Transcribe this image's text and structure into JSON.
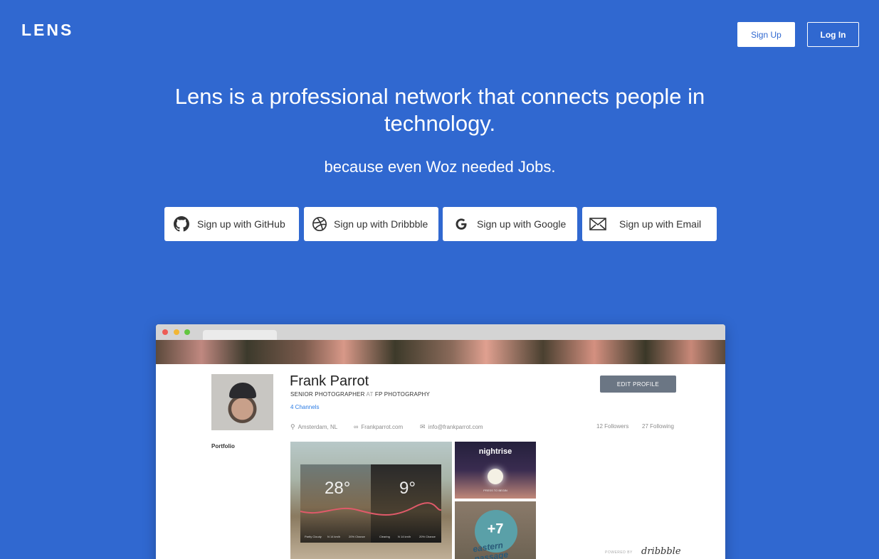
{
  "header": {
    "logo": "LENS",
    "signup_label": "Sign Up",
    "login_label": "Log In"
  },
  "hero": {
    "headline": "Lens is a professional network that connects people in technology.",
    "subline": "because even Woz needed Jobs."
  },
  "providers": [
    {
      "label": "Sign up with GitHub",
      "icon": "github-icon"
    },
    {
      "label": "Sign up with Dribbble",
      "icon": "dribbble-icon"
    },
    {
      "label": "Sign up with Google",
      "icon": "google-icon"
    },
    {
      "label": "Sign up with Email",
      "icon": "email-icon"
    }
  ],
  "mockup": {
    "window_dot_colors": [
      "#ee5c54",
      "#f2b634",
      "#63c640"
    ],
    "profile": {
      "name": "Frank Parrot",
      "title_part1": "SENIOR PHOTOGRAPHER",
      "title_at": "AT",
      "title_company": "FP PHOTOGRAPHY",
      "channels": "4 Channels",
      "edit_button": "EDIT PROFILE",
      "location": "Amsterdam, NL",
      "website": "Frankparrot.com",
      "email": "info@frankparrot.com",
      "followers": "12 Followers",
      "following": "27 Following",
      "portfolio_label": "Portfolio"
    },
    "tiles": {
      "weather_temp_left": "28°",
      "weather_temp_right": "9°",
      "weather_labels": [
        "Partly Cloudy",
        "N 14 km/h",
        "20% Chance",
        "Clearing",
        "N 14 km/h",
        "20% Chance"
      ],
      "night_title": "nightrise",
      "night_sub": "PRESS TO BEGIN",
      "plus_count": "+7",
      "plus_caption": "eastern passage"
    },
    "powered_by": "POWERED BY",
    "powered_brand": "dribbble"
  },
  "colors": {
    "background": "#3068d0",
    "button_text": "#333333",
    "link": "#2a7be4"
  }
}
